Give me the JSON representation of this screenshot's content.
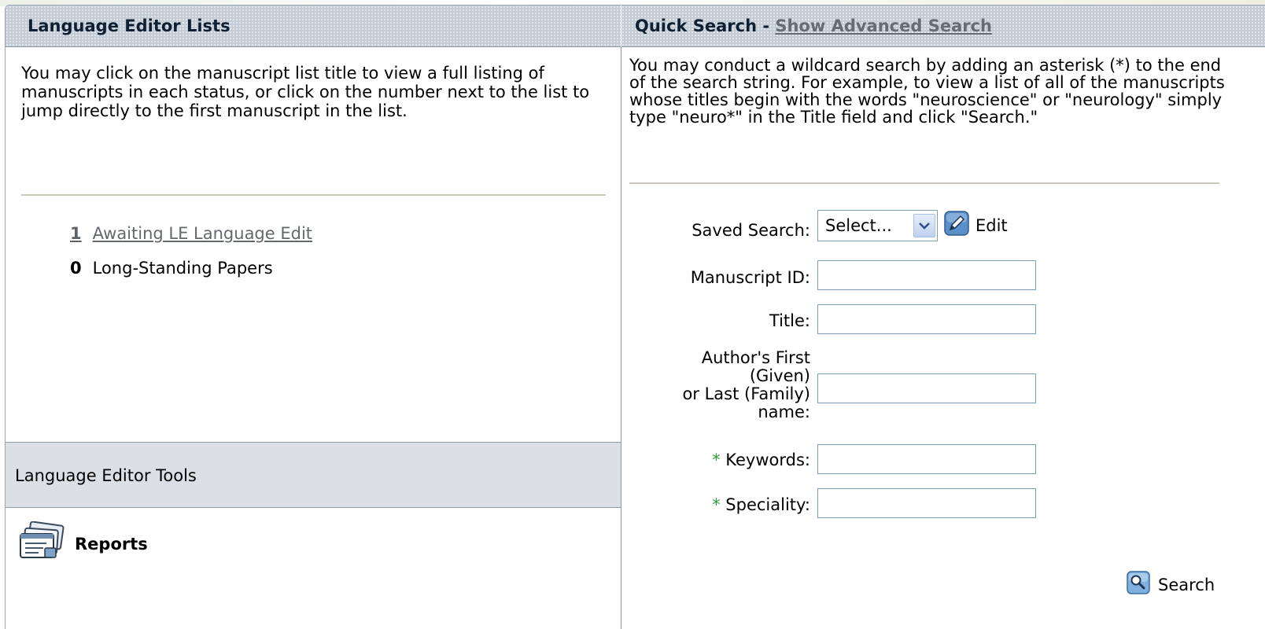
{
  "left_panel": {
    "header": "Language Editor Lists",
    "instructions": "You may click on the manuscript list title to view a full listing of manuscripts in each status, or click on the number next to the list to jump directly to the first manuscript in the list.",
    "lists": [
      {
        "count": "1",
        "title": "Awaiting LE Language Edit"
      },
      {
        "count": "0",
        "title": "Long-Standing Papers"
      }
    ],
    "tools_header": "Language Editor Tools",
    "reports_label": "Reports"
  },
  "right_panel": {
    "header": "Quick Search - ",
    "advanced_link": "Show Advanced Search",
    "instructions": "You may conduct a wildcard search by adding an asterisk (*) to the end of the search string. For example, to view a list of all of the manuscripts whose titles begin with the words \"neuroscience\" or \"neurology\" simply type \"neuro*\" in the Title field and click \"Search.\"",
    "form": {
      "saved_search_label": "Saved Search:",
      "saved_search_value": "Select...",
      "edit_label": "Edit",
      "manuscript_id_label": "Manuscript ID:",
      "manuscript_id_value": "",
      "title_label": "Title:",
      "title_value": "",
      "author_label_lines": [
        "Author's First",
        "(Given)",
        "or Last (Family)",
        "name:"
      ],
      "author_value": "",
      "required_marker": "*",
      "keywords_label": " Keywords:",
      "keywords_value": "",
      "speciality_label": " Speciality:",
      "speciality_value": "",
      "search_label": "Search"
    }
  },
  "colors": {
    "header_bg": "#c3ccd6",
    "tools_bg": "#dbe0e6",
    "link_gray": "#64696e",
    "required_green": "#2f9a3a",
    "input_border": "#7f9db9"
  },
  "icons": {
    "reports": "reports-icon",
    "edit": "pencil-edit-icon",
    "search": "magnifier-icon",
    "dropdown": "chevron-down-icon"
  }
}
